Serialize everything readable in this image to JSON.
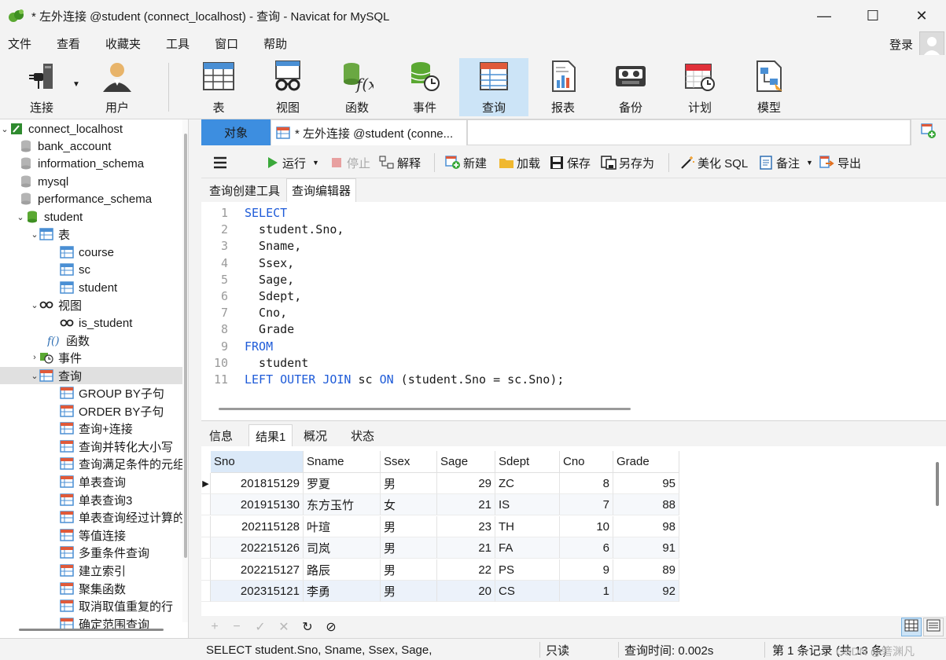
{
  "window": {
    "title": "* 左外连接 @student (connect_localhost) - 查询 - Navicat for MySQL",
    "controls": {
      "minimize": "—",
      "maximize": "☐",
      "close": "✕"
    }
  },
  "menu": {
    "items": [
      "文件",
      "查看",
      "收藏夹",
      "工具",
      "窗口",
      "帮助"
    ],
    "login": "登录"
  },
  "toolbar": {
    "tools": [
      {
        "id": "connect",
        "label": "连接",
        "icon": "plug-icon"
      },
      {
        "id": "user",
        "label": "用户",
        "icon": "user-icon"
      },
      {
        "id": "table",
        "label": "表",
        "icon": "table-icon"
      },
      {
        "id": "view",
        "label": "视图",
        "icon": "glasses-icon"
      },
      {
        "id": "function",
        "label": "函数",
        "icon": "function-icon"
      },
      {
        "id": "event",
        "label": "事件",
        "icon": "event-icon"
      },
      {
        "id": "query",
        "label": "查询",
        "icon": "query-icon",
        "active": true
      },
      {
        "id": "report",
        "label": "报表",
        "icon": "report-icon"
      },
      {
        "id": "backup",
        "label": "备份",
        "icon": "backup-icon"
      },
      {
        "id": "schedule",
        "label": "计划",
        "icon": "calendar-icon"
      },
      {
        "id": "model",
        "label": "模型",
        "icon": "model-icon"
      }
    ]
  },
  "sidebar": {
    "connection": "connect_localhost",
    "databases": [
      "bank_account",
      "information_schema",
      "mysql",
      "performance_schema"
    ],
    "current_db": "student",
    "tables_label": "表",
    "tables": [
      "course",
      "sc",
      "student"
    ],
    "views_label": "视图",
    "views": [
      "is_student"
    ],
    "functions_label": "函数",
    "events_label": "事件",
    "queries_label": "查询",
    "queries": [
      "GROUP BY子句",
      "ORDER BY子句",
      "查询+连接",
      "查询并转化大小写",
      "查询满足条件的元组",
      "单表查询",
      "单表查询3",
      "单表查询经过计算的值",
      "等值连接",
      "多重条件查询",
      "建立索引",
      "聚集函数",
      "取消取值重复的行",
      "确定范围查询"
    ]
  },
  "tabs": {
    "objects": "对象",
    "query_tab": "* 左外连接 @student (conne..."
  },
  "query_toolbar": {
    "run": "运行",
    "stop": "停止",
    "explain": "解释",
    "new": "新建",
    "load": "加载",
    "save": "保存",
    "save_as": "另存为",
    "beautify": "美化 SQL",
    "comment": "备注",
    "export": "导出"
  },
  "subtabs": {
    "builder": "查询创建工具",
    "editor": "查询编辑器"
  },
  "editor": {
    "lines": [
      {
        "n": "1",
        "parts": [
          [
            "kw",
            "SELECT"
          ]
        ]
      },
      {
        "n": "2",
        "parts": [
          [
            "tx",
            "  student.Sno,"
          ]
        ]
      },
      {
        "n": "3",
        "parts": [
          [
            "tx",
            "  Sname,"
          ]
        ]
      },
      {
        "n": "4",
        "parts": [
          [
            "tx",
            "  Ssex,"
          ]
        ]
      },
      {
        "n": "5",
        "parts": [
          [
            "tx",
            "  Sage,"
          ]
        ]
      },
      {
        "n": "6",
        "parts": [
          [
            "tx",
            "  Sdept,"
          ]
        ]
      },
      {
        "n": "7",
        "parts": [
          [
            "tx",
            "  Cno,"
          ]
        ]
      },
      {
        "n": "8",
        "parts": [
          [
            "tx",
            "  Grade"
          ]
        ]
      },
      {
        "n": "9",
        "parts": [
          [
            "kw",
            "FROM"
          ]
        ]
      },
      {
        "n": "10",
        "parts": [
          [
            "tx",
            "  student"
          ]
        ]
      },
      {
        "n": "11",
        "parts": [
          [
            "kw",
            "LEFT OUTER JOIN"
          ],
          [
            "tx",
            " sc "
          ],
          [
            "kw",
            "ON"
          ],
          [
            "tx",
            " (student.Sno = sc.Sno);"
          ]
        ]
      }
    ]
  },
  "result_tabs": [
    "信息",
    "结果1",
    "概况",
    "状态"
  ],
  "grid": {
    "columns": [
      "Sno",
      "Sname",
      "Ssex",
      "Sage",
      "Sdept",
      "Cno",
      "Grade"
    ],
    "rows": [
      [
        "201815129",
        "罗夏",
        "男",
        "29",
        "ZC",
        "8",
        "95"
      ],
      [
        "201915130",
        "东方玉竹",
        "女",
        "21",
        "IS",
        "7",
        "88"
      ],
      [
        "202115128",
        "叶瑄",
        "男",
        "23",
        "TH",
        "10",
        "98"
      ],
      [
        "202215126",
        "司岚",
        "男",
        "21",
        "FA",
        "6",
        "91"
      ],
      [
        "202215127",
        "路辰",
        "男",
        "22",
        "PS",
        "9",
        "89"
      ],
      [
        "202315121",
        "李勇",
        "男",
        "20",
        "CS",
        "1",
        "92"
      ]
    ]
  },
  "grid_footer": {
    "add": "+",
    "delete": "−",
    "apply": "✓",
    "cancel": "✕",
    "refresh": "↻",
    "stop": "⊘"
  },
  "status": {
    "sql": "SELECT   student.Sno,         Sname,    Ssex,       Sage,",
    "readonly": "只读",
    "query_time": "查询时间: 0.002s",
    "records": "第 1 条记录 (共 13 条)",
    "watermark": "CSDN @箬渊凡"
  }
}
